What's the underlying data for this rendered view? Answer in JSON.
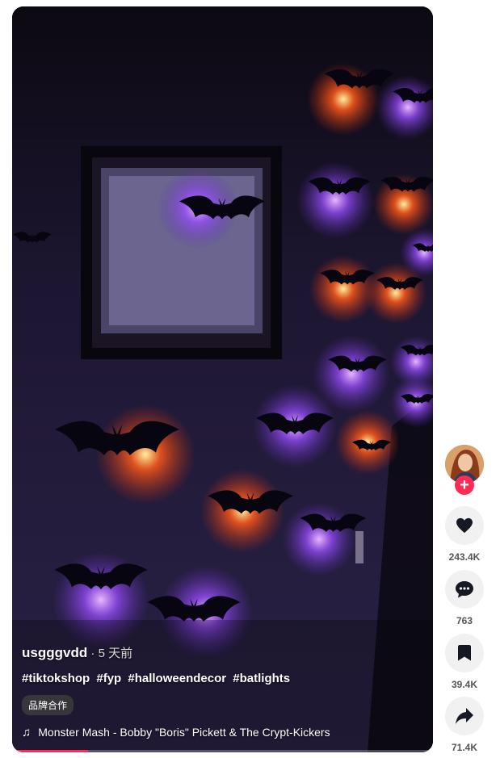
{
  "video": {
    "author": "usgggvdd",
    "time_separator": " · ",
    "time": "5 天前",
    "hashtags": [
      "#tiktokshop",
      "#fyp",
      "#halloweendecor",
      "#batlights"
    ],
    "badge": "品牌合作",
    "music": "Monster Mash - Bobby \"Boris\" Pickett & The Crypt-Kickers",
    "progress": 0.18
  },
  "actions": {
    "like_count": "243.4K",
    "comment_count": "763",
    "save_count": "39.4K",
    "share_count": "71.4K",
    "follow_label": "+"
  },
  "icons": {
    "music": "music-note-icon",
    "like": "heart-icon",
    "comment": "comment-bubble-icon",
    "save": "bookmark-icon",
    "share": "share-arrow-icon"
  },
  "colors": {
    "accent": "#fe2c55",
    "action_bg": "#f1f1f2",
    "glow_purple": "#b45cff",
    "glow_orange": "#ff6a1a"
  }
}
